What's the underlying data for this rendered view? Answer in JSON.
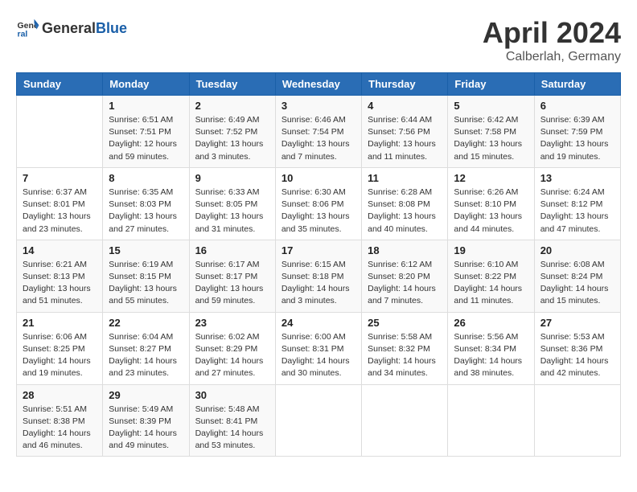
{
  "header": {
    "logo_general": "General",
    "logo_blue": "Blue",
    "month_title": "April 2024",
    "location": "Calberlah, Germany"
  },
  "days_of_week": [
    "Sunday",
    "Monday",
    "Tuesday",
    "Wednesday",
    "Thursday",
    "Friday",
    "Saturday"
  ],
  "weeks": [
    [
      {
        "day": "",
        "info": ""
      },
      {
        "day": "1",
        "info": "Sunrise: 6:51 AM\nSunset: 7:51 PM\nDaylight: 12 hours\nand 59 minutes."
      },
      {
        "day": "2",
        "info": "Sunrise: 6:49 AM\nSunset: 7:52 PM\nDaylight: 13 hours\nand 3 minutes."
      },
      {
        "day": "3",
        "info": "Sunrise: 6:46 AM\nSunset: 7:54 PM\nDaylight: 13 hours\nand 7 minutes."
      },
      {
        "day": "4",
        "info": "Sunrise: 6:44 AM\nSunset: 7:56 PM\nDaylight: 13 hours\nand 11 minutes."
      },
      {
        "day": "5",
        "info": "Sunrise: 6:42 AM\nSunset: 7:58 PM\nDaylight: 13 hours\nand 15 minutes."
      },
      {
        "day": "6",
        "info": "Sunrise: 6:39 AM\nSunset: 7:59 PM\nDaylight: 13 hours\nand 19 minutes."
      }
    ],
    [
      {
        "day": "7",
        "info": "Sunrise: 6:37 AM\nSunset: 8:01 PM\nDaylight: 13 hours\nand 23 minutes."
      },
      {
        "day": "8",
        "info": "Sunrise: 6:35 AM\nSunset: 8:03 PM\nDaylight: 13 hours\nand 27 minutes."
      },
      {
        "day": "9",
        "info": "Sunrise: 6:33 AM\nSunset: 8:05 PM\nDaylight: 13 hours\nand 31 minutes."
      },
      {
        "day": "10",
        "info": "Sunrise: 6:30 AM\nSunset: 8:06 PM\nDaylight: 13 hours\nand 35 minutes."
      },
      {
        "day": "11",
        "info": "Sunrise: 6:28 AM\nSunset: 8:08 PM\nDaylight: 13 hours\nand 40 minutes."
      },
      {
        "day": "12",
        "info": "Sunrise: 6:26 AM\nSunset: 8:10 PM\nDaylight: 13 hours\nand 44 minutes."
      },
      {
        "day": "13",
        "info": "Sunrise: 6:24 AM\nSunset: 8:12 PM\nDaylight: 13 hours\nand 47 minutes."
      }
    ],
    [
      {
        "day": "14",
        "info": "Sunrise: 6:21 AM\nSunset: 8:13 PM\nDaylight: 13 hours\nand 51 minutes."
      },
      {
        "day": "15",
        "info": "Sunrise: 6:19 AM\nSunset: 8:15 PM\nDaylight: 13 hours\nand 55 minutes."
      },
      {
        "day": "16",
        "info": "Sunrise: 6:17 AM\nSunset: 8:17 PM\nDaylight: 13 hours\nand 59 minutes."
      },
      {
        "day": "17",
        "info": "Sunrise: 6:15 AM\nSunset: 8:18 PM\nDaylight: 14 hours\nand 3 minutes."
      },
      {
        "day": "18",
        "info": "Sunrise: 6:12 AM\nSunset: 8:20 PM\nDaylight: 14 hours\nand 7 minutes."
      },
      {
        "day": "19",
        "info": "Sunrise: 6:10 AM\nSunset: 8:22 PM\nDaylight: 14 hours\nand 11 minutes."
      },
      {
        "day": "20",
        "info": "Sunrise: 6:08 AM\nSunset: 8:24 PM\nDaylight: 14 hours\nand 15 minutes."
      }
    ],
    [
      {
        "day": "21",
        "info": "Sunrise: 6:06 AM\nSunset: 8:25 PM\nDaylight: 14 hours\nand 19 minutes."
      },
      {
        "day": "22",
        "info": "Sunrise: 6:04 AM\nSunset: 8:27 PM\nDaylight: 14 hours\nand 23 minutes."
      },
      {
        "day": "23",
        "info": "Sunrise: 6:02 AM\nSunset: 8:29 PM\nDaylight: 14 hours\nand 27 minutes."
      },
      {
        "day": "24",
        "info": "Sunrise: 6:00 AM\nSunset: 8:31 PM\nDaylight: 14 hours\nand 30 minutes."
      },
      {
        "day": "25",
        "info": "Sunrise: 5:58 AM\nSunset: 8:32 PM\nDaylight: 14 hours\nand 34 minutes."
      },
      {
        "day": "26",
        "info": "Sunrise: 5:56 AM\nSunset: 8:34 PM\nDaylight: 14 hours\nand 38 minutes."
      },
      {
        "day": "27",
        "info": "Sunrise: 5:53 AM\nSunset: 8:36 PM\nDaylight: 14 hours\nand 42 minutes."
      }
    ],
    [
      {
        "day": "28",
        "info": "Sunrise: 5:51 AM\nSunset: 8:38 PM\nDaylight: 14 hours\nand 46 minutes."
      },
      {
        "day": "29",
        "info": "Sunrise: 5:49 AM\nSunset: 8:39 PM\nDaylight: 14 hours\nand 49 minutes."
      },
      {
        "day": "30",
        "info": "Sunrise: 5:48 AM\nSunset: 8:41 PM\nDaylight: 14 hours\nand 53 minutes."
      },
      {
        "day": "",
        "info": ""
      },
      {
        "day": "",
        "info": ""
      },
      {
        "day": "",
        "info": ""
      },
      {
        "day": "",
        "info": ""
      }
    ]
  ]
}
